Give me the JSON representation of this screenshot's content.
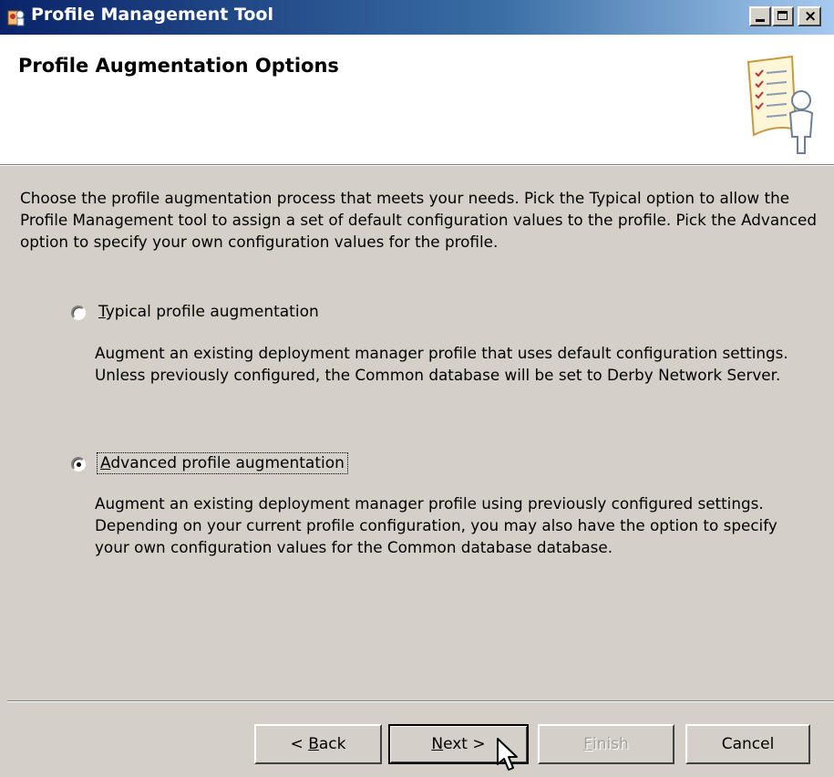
{
  "window": {
    "title": "Profile Management Tool",
    "controls": [
      "minimize",
      "maximize",
      "close"
    ]
  },
  "header": {
    "title": "Profile Augmentation Options",
    "illustration": "wizard-checklist-person-icon"
  },
  "intro": "Choose the profile augmentation process that meets your needs. Pick the Typical option to allow the Profile Management tool to assign a set of default configuration values to the profile. Pick the Advanced option to specify your own configuration values for the profile.",
  "options": [
    {
      "label_mnemonic": "T",
      "label_rest": "ypical profile augmentation",
      "selected": false,
      "description": "Augment an existing deployment manager profile that uses default configuration settings. Unless previously configured, the Common database will be set to Derby Network Server."
    },
    {
      "label_mnemonic": "A",
      "label_rest": "dvanced profile augmentation",
      "selected": true,
      "description": "Augment an existing deployment manager profile using previously configured settings. Depending on your current profile configuration, you may also have the option to specify your own configuration values for the Common database database."
    }
  ],
  "buttons": {
    "back_prefix": "< ",
    "back_mnemonic": "B",
    "back_rest": "ack",
    "next_mnemonic": "N",
    "next_rest": "ext >",
    "finish_mnemonic": "F",
    "finish_rest": "inish",
    "finish_enabled": false,
    "cancel": "Cancel"
  },
  "colors": {
    "title_bar_start": "#0a246a",
    "title_bar_end": "#a6caf0",
    "dialog_face": "#d4d0c8",
    "disabled_text": "#a0a0a0"
  }
}
